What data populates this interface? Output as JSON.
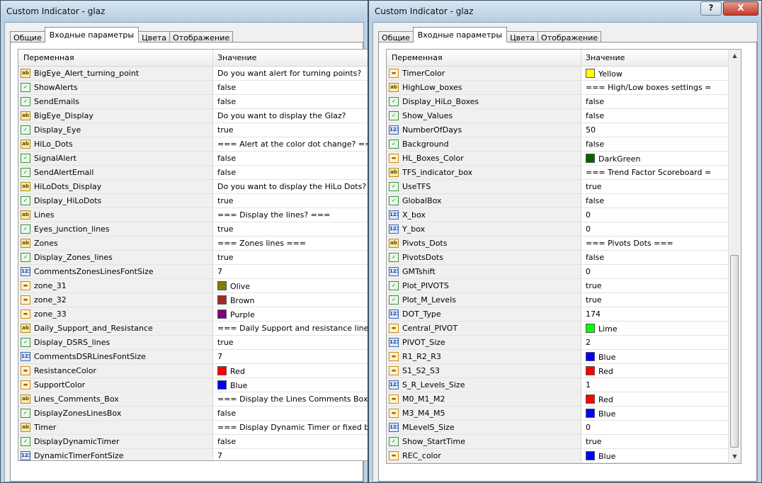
{
  "left_window": {
    "title": "Custom Indicator - glaz",
    "tabs": [
      {
        "label": "Общие"
      },
      {
        "label": "Входные параметры"
      },
      {
        "label": "Цвета"
      },
      {
        "label": "Отображение"
      }
    ],
    "headers": {
      "variable": "Переменная",
      "value": "Значение"
    },
    "rows": [
      {
        "type": "string-icon",
        "name": "BigEye_Alert_turning_point",
        "value": "Do you want alert for turning points?"
      },
      {
        "type": "bool-icon",
        "name": "ShowAlerts",
        "value": "false"
      },
      {
        "type": "bool-icon",
        "name": "SendEmails",
        "value": "false"
      },
      {
        "type": "string-icon",
        "name": "BigEye_Display",
        "value": "Do you want to display the Glaz?"
      },
      {
        "type": "bool-icon",
        "name": "Display_Eye",
        "value": "true"
      },
      {
        "type": "string-icon",
        "name": "HiLo_Dots",
        "value": "=== Alert at the color dot change? ==="
      },
      {
        "type": "bool-icon",
        "name": "SignalAlert",
        "value": "false"
      },
      {
        "type": "bool-icon",
        "name": "SendAlertEmail",
        "value": "false"
      },
      {
        "type": "string-icon",
        "name": "HiLoDots_Display",
        "value": "Do you want to display the HiLo Dots?"
      },
      {
        "type": "bool-icon",
        "name": "Display_HiLoDots",
        "value": "true"
      },
      {
        "type": "string-icon",
        "name": "Lines",
        "value": "=== Display the lines? ==="
      },
      {
        "type": "bool-icon",
        "name": "Eyes_junction_lines",
        "value": "true"
      },
      {
        "type": "string-icon",
        "name": "Zones",
        "value": "=== Zones lines ==="
      },
      {
        "type": "bool-icon",
        "name": "Display_Zones_lines",
        "value": "true"
      },
      {
        "type": "int-icon",
        "name": "CommentsZonesLinesFontSize",
        "value": "7"
      },
      {
        "type": "color-icon",
        "name": "zone_31",
        "value": "Olive",
        "swatch": "#808000"
      },
      {
        "type": "color-icon",
        "name": "zone_32",
        "value": "Brown",
        "swatch": "#a52a2a"
      },
      {
        "type": "color-icon",
        "name": "zone_33",
        "value": "Purple",
        "swatch": "#800080"
      },
      {
        "type": "string-icon",
        "name": "Daily_Support_and_Resistance",
        "value": "=== Daily Support and resistance lines ==="
      },
      {
        "type": "bool-icon",
        "name": "Display_DSRS_lines",
        "value": "true"
      },
      {
        "type": "int-icon",
        "name": "CommentsDSRLinesFontSize",
        "value": "7"
      },
      {
        "type": "color-icon",
        "name": "ResistanceColor",
        "value": "Red",
        "swatch": "#ff0000"
      },
      {
        "type": "color-icon",
        "name": "SupportColor",
        "value": "Blue",
        "swatch": "#0000ff"
      },
      {
        "type": "string-icon",
        "name": "Lines_Comments_Box",
        "value": "=== Display the Lines Comments Box? ==="
      },
      {
        "type": "bool-icon",
        "name": "DisplayZonesLinesBox",
        "value": "false"
      },
      {
        "type": "string-icon",
        "name": "Timer",
        "value": "=== Display Dynamic Timer or fixed box? ==="
      },
      {
        "type": "bool-icon",
        "name": "DisplayDynamicTimer",
        "value": "false"
      },
      {
        "type": "int-icon",
        "name": "DynamicTimerFontSize",
        "value": "7"
      }
    ]
  },
  "right_window": {
    "title": "Custom Indicator - glaz",
    "help_button": "?",
    "close_button": "X",
    "tabs": [
      {
        "label": "Общие"
      },
      {
        "label": "Входные параметры"
      },
      {
        "label": "Цвета"
      },
      {
        "label": "Отображение"
      }
    ],
    "headers": {
      "variable": "Переменная",
      "value": "Значение"
    },
    "scroll_up_icon": "▲",
    "scroll_down_icon": "▼",
    "rows": [
      {
        "type": "color-icon",
        "name": "TimerColor",
        "value": "Yellow",
        "swatch": "#ffff00"
      },
      {
        "type": "string-icon",
        "name": "HighLow_boxes",
        "value": "=== High/Low boxes settings ="
      },
      {
        "type": "bool-icon",
        "name": "Display_HiLo_Boxes",
        "value": "false"
      },
      {
        "type": "bool-icon",
        "name": "Show_Values",
        "value": "false"
      },
      {
        "type": "int-icon",
        "name": "NumberOfDays",
        "value": "50"
      },
      {
        "type": "bool-icon",
        "name": "Background",
        "value": "false"
      },
      {
        "type": "color-icon",
        "name": "HL_Boxes_Color",
        "value": "DarkGreen",
        "swatch": "#006400"
      },
      {
        "type": "string-icon",
        "name": "TFS_indicator_box",
        "value": "=== Trend Factor Scoreboard ="
      },
      {
        "type": "bool-icon",
        "name": "UseTFS",
        "value": "true"
      },
      {
        "type": "bool-icon",
        "name": "GlobalBox",
        "value": "false"
      },
      {
        "type": "int-icon",
        "name": "X_box",
        "value": "0"
      },
      {
        "type": "int-icon",
        "name": "Y_box",
        "value": "0"
      },
      {
        "type": "string-icon",
        "name": "Pivots_Dots",
        "value": "=== Pivots Dots ==="
      },
      {
        "type": "bool-icon",
        "name": "PivotsDots",
        "value": "false"
      },
      {
        "type": "int-icon",
        "name": "GMTshift",
        "value": "0"
      },
      {
        "type": "bool-icon",
        "name": "Plot_PIVOTS",
        "value": "true"
      },
      {
        "type": "bool-icon",
        "name": "Plot_M_Levels",
        "value": "true"
      },
      {
        "type": "int-icon",
        "name": "DOT_Type",
        "value": "174"
      },
      {
        "type": "color-icon",
        "name": "Central_PIVOT",
        "value": "Lime",
        "swatch": "#00ff00"
      },
      {
        "type": "int-icon",
        "name": "PIVOT_Size",
        "value": "2"
      },
      {
        "type": "color-icon",
        "name": "R1_R2_R3",
        "value": "Blue",
        "swatch": "#0000ff"
      },
      {
        "type": "color-icon",
        "name": "S1_S2_S3",
        "value": "Red",
        "swatch": "#ff0000"
      },
      {
        "type": "int-icon",
        "name": "S_R_Levels_Size",
        "value": "1"
      },
      {
        "type": "color-icon",
        "name": "M0_M1_M2",
        "value": "Red",
        "swatch": "#ff0000"
      },
      {
        "type": "color-icon",
        "name": "M3_M4_M5",
        "value": "Blue",
        "swatch": "#0000ff"
      },
      {
        "type": "int-icon",
        "name": "MLevelS_Size",
        "value": "0"
      },
      {
        "type": "bool-icon",
        "name": "Show_StartTime",
        "value": "true"
      },
      {
        "type": "color-icon",
        "name": "REC_color",
        "value": "Blue",
        "swatch": "#0000ff"
      }
    ]
  }
}
